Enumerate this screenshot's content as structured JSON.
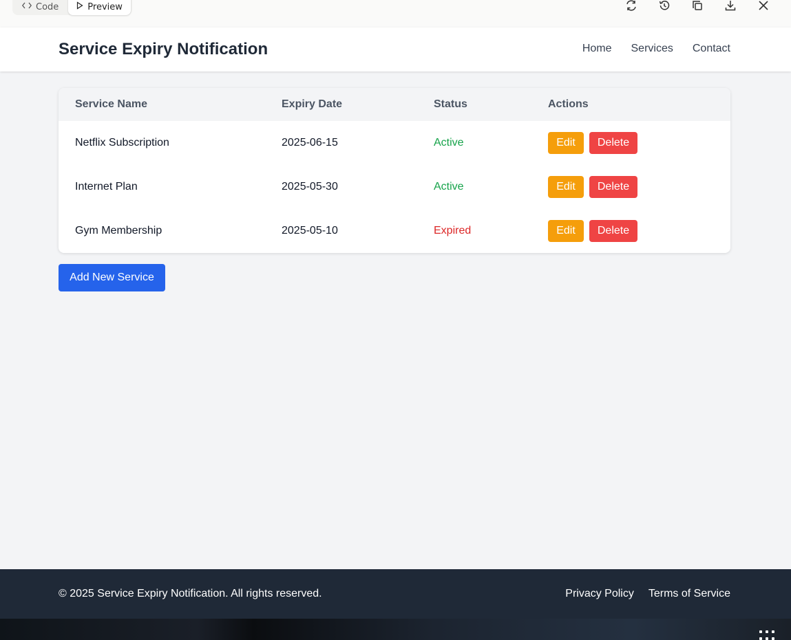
{
  "toolbar": {
    "tabs": [
      {
        "label": "Code",
        "icon": "code-icon"
      },
      {
        "label": "Preview",
        "icon": "play-icon"
      }
    ],
    "icons": [
      "refresh-icon",
      "history-icon",
      "copy-icon",
      "download-icon",
      "close-icon"
    ]
  },
  "header": {
    "title": "Service Expiry Notification",
    "nav": [
      "Home",
      "Services",
      "Contact"
    ]
  },
  "table": {
    "columns": [
      "Service Name",
      "Expiry Date",
      "Status",
      "Actions"
    ],
    "rows": [
      {
        "name": "Netflix Subscription",
        "expiry": "2025-06-15",
        "status": "Active",
        "edit": "Edit",
        "delete": "Delete"
      },
      {
        "name": "Internet Plan",
        "expiry": "2025-05-30",
        "status": "Active",
        "edit": "Edit",
        "delete": "Delete"
      },
      {
        "name": "Gym Membership",
        "expiry": "2025-05-10",
        "status": "Expired",
        "edit": "Edit",
        "delete": "Delete"
      }
    ]
  },
  "add_button": "Add New Service",
  "footer": {
    "copyright": "© 2025 Service Expiry Notification. All rights reserved.",
    "links": [
      "Privacy Policy",
      "Terms of Service"
    ]
  },
  "colors": {
    "primary": "#2563eb",
    "edit": "#f59e0b",
    "delete": "#ef4444",
    "active": "#16a34a",
    "expired": "#dc2626",
    "footer_bg": "#1f2937"
  }
}
